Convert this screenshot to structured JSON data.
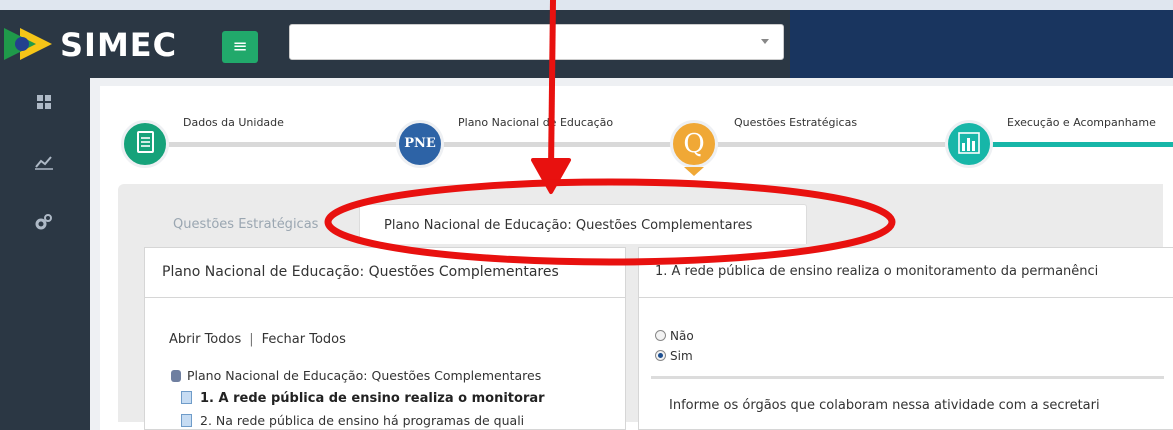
{
  "app": {
    "name": "SIMEC"
  },
  "topbar": {
    "search_value": ""
  },
  "sidebar": {
    "icons": [
      "dashboard-icon",
      "chart-icon",
      "gears-icon"
    ]
  },
  "steps": [
    {
      "label": "Dados da Unidade",
      "icon": "document-icon",
      "color": "#16a27a",
      "badge": ""
    },
    {
      "label": "Plano Nacional de Educação",
      "icon": "pne-icon",
      "color": "#2d63a6",
      "badge": "PNE"
    },
    {
      "label": "Questões Estratégicas",
      "icon": "question-icon",
      "color": "#f0a836",
      "badge": "Q"
    },
    {
      "label": "Execução e Acompanhame",
      "icon": "bar-chart-icon",
      "color": "#17b6a8",
      "badge": ""
    }
  ],
  "tabs": {
    "inactive": "Questões Estratégicas",
    "active": "Plano Nacional de Educação: Questões Complementares"
  },
  "tree": {
    "header": "Plano Nacional de Educação: Questões Complementares",
    "open_all": "Abrir Todos",
    "separator": "|",
    "close_all": "Fechar Todos",
    "root": "Plano Nacional de Educação: Questões Complementares",
    "items": [
      "1. A rede pública de ensino realiza o monitorar",
      "2. Na rede pública de ensino há programas de quali"
    ]
  },
  "question": {
    "title": "1. A rede pública de ensino realiza o monitoramento da permanênci",
    "options": [
      "Não",
      "Sim"
    ],
    "selected": "Sim",
    "subquestion": "Informe os órgãos que colaboram nessa atividade com a secretari"
  }
}
